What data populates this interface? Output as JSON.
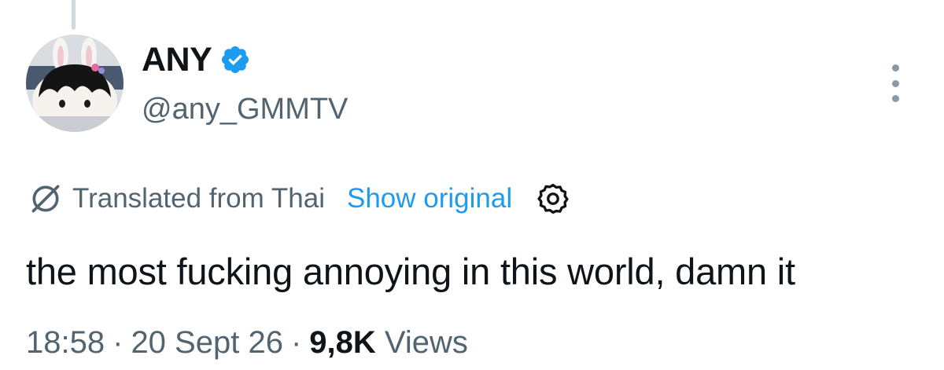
{
  "tweet": {
    "author": {
      "display_name": "ANY",
      "handle": "@any_GMMTV",
      "verified": true,
      "avatar_icon": "plush-avatar"
    },
    "translation": {
      "label": "Translated from Thai",
      "show_original": "Show original",
      "icon": "translate-icon",
      "settings_icon": "gear-icon"
    },
    "text": "the most fucking annoying in this world, damn it",
    "meta": {
      "time": "18:58",
      "separator": "·",
      "date": "20 Sept 26",
      "views_count": "9,8K",
      "views_label": "Views"
    }
  },
  "colors": {
    "text_primary": "#0f1419",
    "text_secondary": "#536471",
    "accent": "#1d9bf0",
    "verified_badge": "#1d9bf0"
  }
}
